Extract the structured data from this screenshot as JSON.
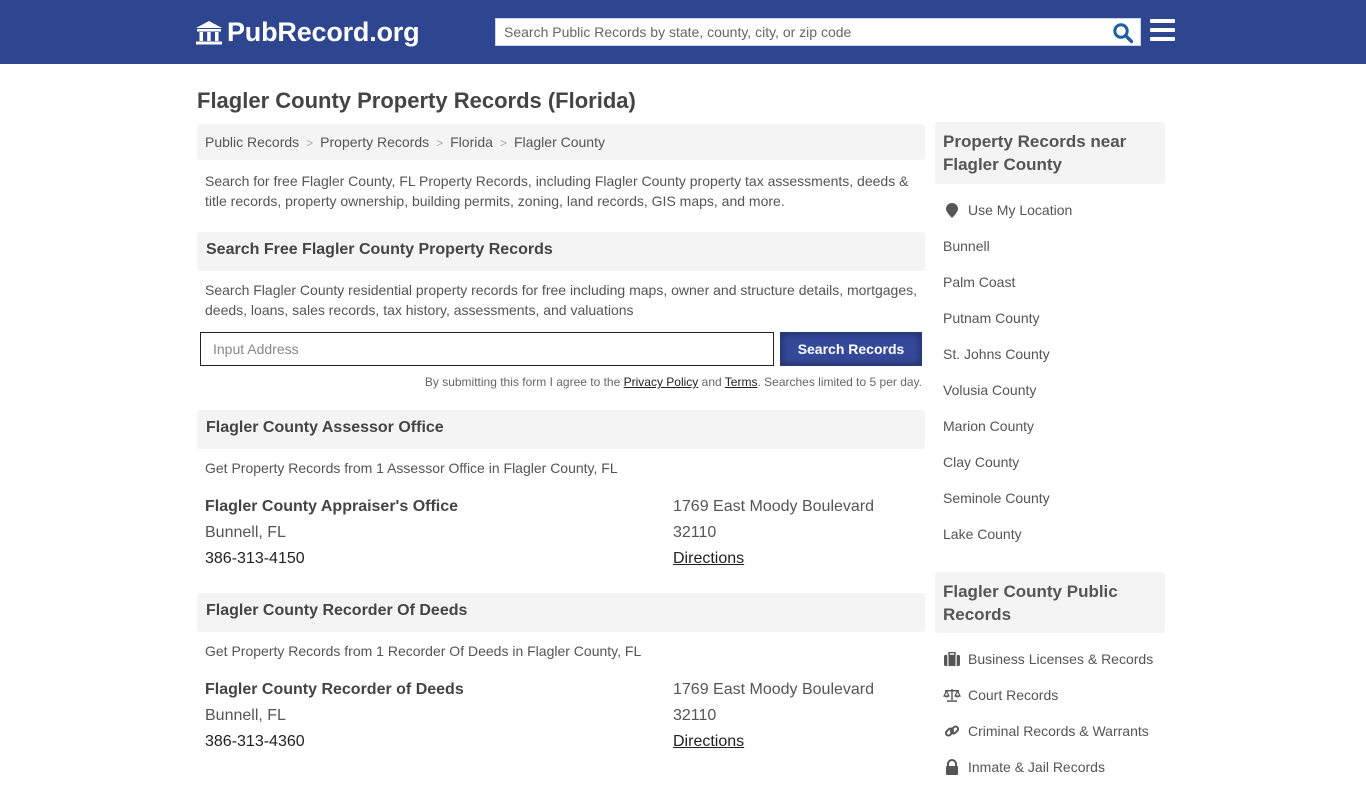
{
  "header": {
    "logo_text": "PubRecord.org",
    "search_placeholder": "Search Public Records by state, county, city, or zip code",
    "search_icon": "search-icon",
    "menu_icon": "hamburger-menu-icon",
    "brand_color": "#2e4690"
  },
  "page": {
    "title": "Flagler County Property Records (Florida)",
    "breadcrumb": [
      "Public Records",
      "Property Records",
      "Florida",
      "Flagler County"
    ],
    "breadcrumb_separator": ">",
    "intro": "Search for free Flagler County, FL Property Records, including Flagler County property tax assessments, deeds & title records, property ownership, building permits, zoning, land records, GIS maps, and more."
  },
  "search_section": {
    "heading": "Search Free Flagler County Property Records",
    "description": "Search Flagler County residential property records for free including maps, owner and structure details, mortgages, deeds, loans, sales records, tax history, assessments, and valuations",
    "input_placeholder": "Input Address",
    "input_value": "",
    "button_label": "Search Records",
    "disclaimer_prefix": "By submitting this form I agree to the ",
    "privacy_link": "Privacy Policy",
    "disclaimer_and": " and ",
    "terms_link": "Terms",
    "disclaimer_suffix": ". Searches limited to 5 per day."
  },
  "sections": [
    {
      "heading": "Flagler County Assessor Office",
      "description": "Get Property Records from 1 Assessor Office in Flagler County, FL",
      "office": {
        "name": "Flagler County Appraiser's Office",
        "city": "Bunnell, FL",
        "phone": "386-313-4150",
        "street": "1769 East Moody Boulevard",
        "zip": "32110",
        "directions": "Directions"
      }
    },
    {
      "heading": "Flagler County Recorder Of Deeds",
      "description": "Get Property Records from 1 Recorder Of Deeds in Flagler County, FL",
      "office": {
        "name": "Flagler County Recorder of Deeds",
        "city": "Bunnell, FL",
        "phone": "386-313-4360",
        "street": "1769 East Moody Boulevard",
        "zip": "32110",
        "directions": "Directions"
      }
    }
  ],
  "sidebar": {
    "nearby_heading": "Property Records near Flagler County",
    "use_location": "Use My Location",
    "nearby": [
      "Bunnell",
      "Palm Coast",
      "Putnam County",
      "St. Johns County",
      "Volusia County",
      "Marion County",
      "Clay County",
      "Seminole County",
      "Lake County"
    ],
    "public_heading": "Flagler County Public Records",
    "public_records": [
      {
        "label": "Business Licenses & Records",
        "icon": "briefcase-icon"
      },
      {
        "label": "Court Records",
        "icon": "scales-icon"
      },
      {
        "label": "Criminal Records & Warrants",
        "icon": "link-icon"
      },
      {
        "label": "Inmate & Jail Records",
        "icon": "lock-icon"
      }
    ]
  }
}
